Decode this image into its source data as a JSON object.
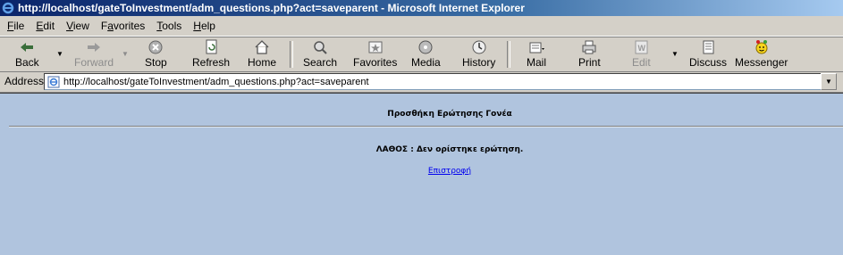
{
  "window": {
    "title": "http://localhost/gateToInvestment/adm_questions.php?act=saveparent - Microsoft Internet Explorer"
  },
  "menu": [
    {
      "label": "File",
      "key": "F"
    },
    {
      "label": "Edit",
      "key": "E"
    },
    {
      "label": "View",
      "key": "V"
    },
    {
      "label": "Favorites",
      "key": "a"
    },
    {
      "label": "Tools",
      "key": "T"
    },
    {
      "label": "Help",
      "key": "H"
    }
  ],
  "toolbar": {
    "back": "Back",
    "forward": "Forward",
    "stop": "Stop",
    "refresh": "Refresh",
    "home": "Home",
    "search": "Search",
    "favorites": "Favorites",
    "media": "Media",
    "history": "History",
    "mail": "Mail",
    "print": "Print",
    "edit": "Edit",
    "discuss": "Discuss",
    "messenger": "Messenger"
  },
  "address": {
    "label": "Address",
    "url": "http://localhost/gateToInvestment/adm_questions.php?act=saveparent"
  },
  "page": {
    "heading": "Προσθήκη Ερώτησης Γονέα",
    "error": "ΛΑΘΟΣ : Δεν ορίστηκε ερώτηση.",
    "back_link": "Επιστροφή"
  }
}
